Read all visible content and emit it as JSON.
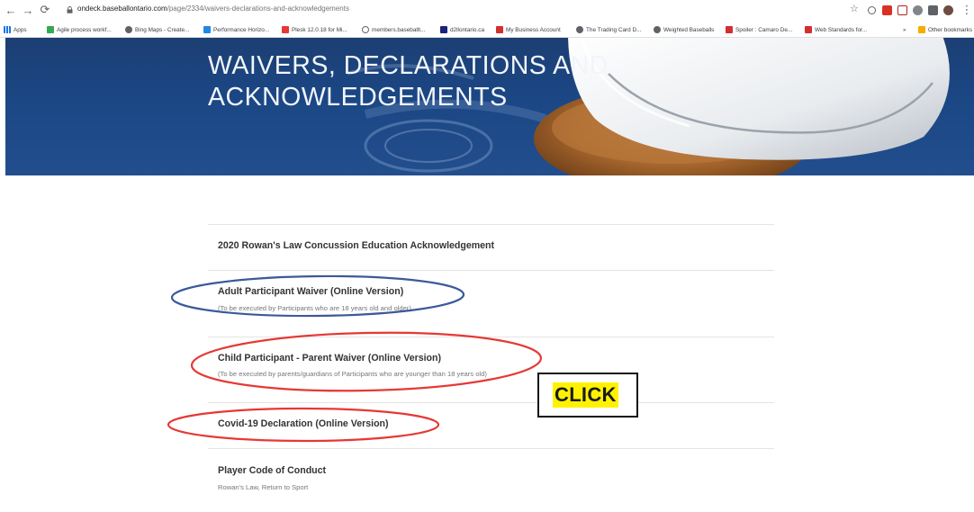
{
  "browser": {
    "url_host": "ondeck.baseballontario.com",
    "url_path": "/page/2334/waivers-declarations-and-acknowledgements",
    "bookmarks": [
      "Apps",
      "Agile process workf...",
      "Bing Maps - Create...",
      "Performance Horizo...",
      "Plesk 12.0.18 for Mi...",
      "members.baseballt...",
      "d2llontario.ca",
      "My Business Account",
      "The Trading Card D...",
      "Weighted Baseballs",
      "Spoiler : Camaro De...",
      "Web Standards for...",
      "Other bookmarks"
    ],
    "overflow_label": "»"
  },
  "hero": {
    "title_line1": "WAIVERS, DECLARATIONS AND",
    "title_line2": "ACKNOWLEDGEMENTS"
  },
  "items": [
    {
      "title": "2020 Rowan's Law Concussion Education Acknowledgement",
      "subtitle": ""
    },
    {
      "title": "Adult Participant Waiver (Online Version)",
      "subtitle": "(To be executed by Participants who are 18 years old and older)"
    },
    {
      "title": "Child Participant - Parent Waiver (Online Version)",
      "subtitle": "(To be executed by parents/guardians of Participants who are younger than 18 years old)"
    },
    {
      "title": "Covid-19 Declaration (Online Version)",
      "subtitle": ""
    },
    {
      "title": "Player Code of Conduct",
      "subtitle": "Rowan's Law, Return to Sport"
    }
  ],
  "annotation": {
    "click_label": "CLICK",
    "highlight_color": "#fff200",
    "circle_blue": "#3b5a9a",
    "circle_red": "#e53935"
  }
}
